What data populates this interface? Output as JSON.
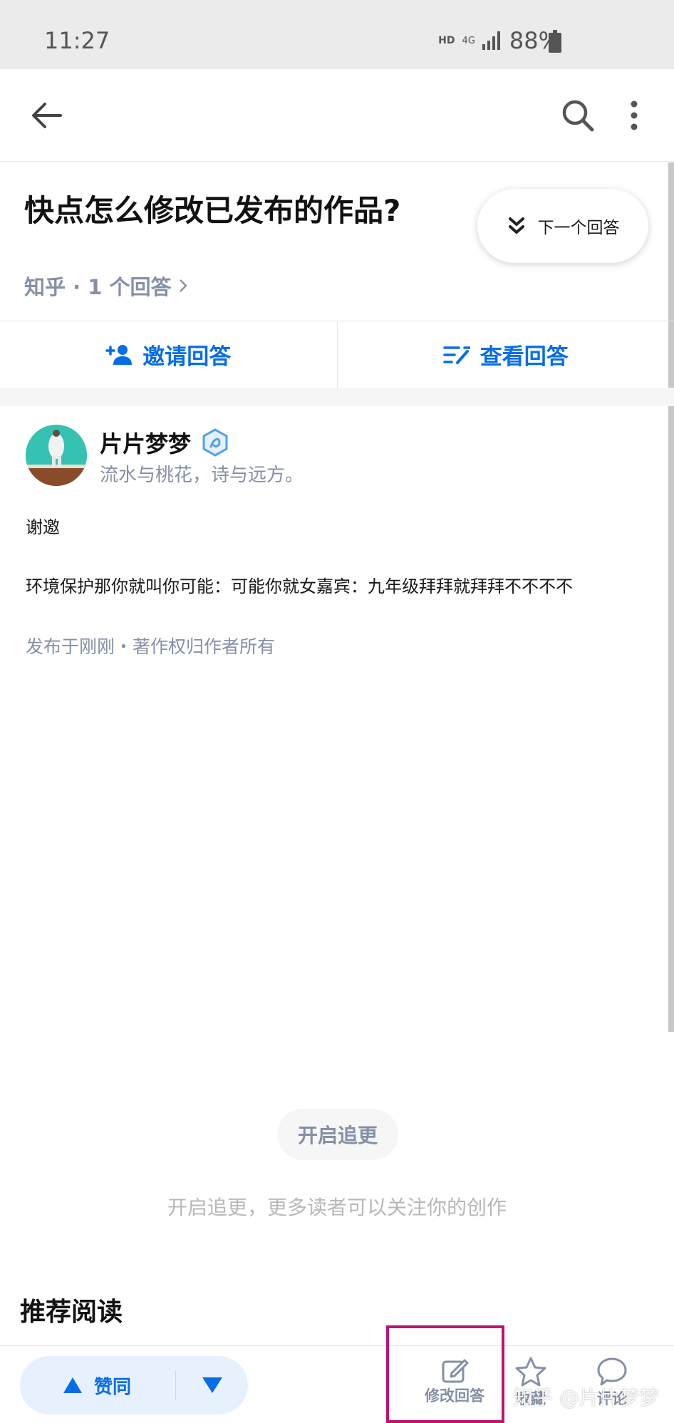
{
  "status_bar": {
    "time": "11:27",
    "hd": "HD",
    "network": "4G",
    "battery": "88%"
  },
  "question": {
    "title": "快点怎么修改已发布的作品?",
    "meta": "知乎 · 1 个回答",
    "next_answer_label": "下一个回答"
  },
  "actions": {
    "invite_label": "邀请回答",
    "view_label": "查看回答"
  },
  "answer": {
    "author_name": "片片梦梦",
    "author_bio": "流水与桃花，诗与远方。",
    "paragraphs": [
      "谢邀",
      "环境保护那你就叫你可能：可能你就女嘉宾：九年级拜拜就拜拜不不不不"
    ],
    "meta": "发布于刚刚・著作权归作者所有"
  },
  "follow": {
    "button_label": "开启追更",
    "hint": "开启追更，更多读者可以关注你的创作"
  },
  "recommend": {
    "title": "推荐阅读"
  },
  "bottom_bar": {
    "upvote_label": "赞同",
    "edit_label": "修改回答",
    "favorite_label": "收藏",
    "comment_label": "评论"
  },
  "watermark": "知乎 @片片梦梦",
  "colors": {
    "accent": "#056de8",
    "highlight": "#c0136f",
    "muted": "#8590a6"
  }
}
